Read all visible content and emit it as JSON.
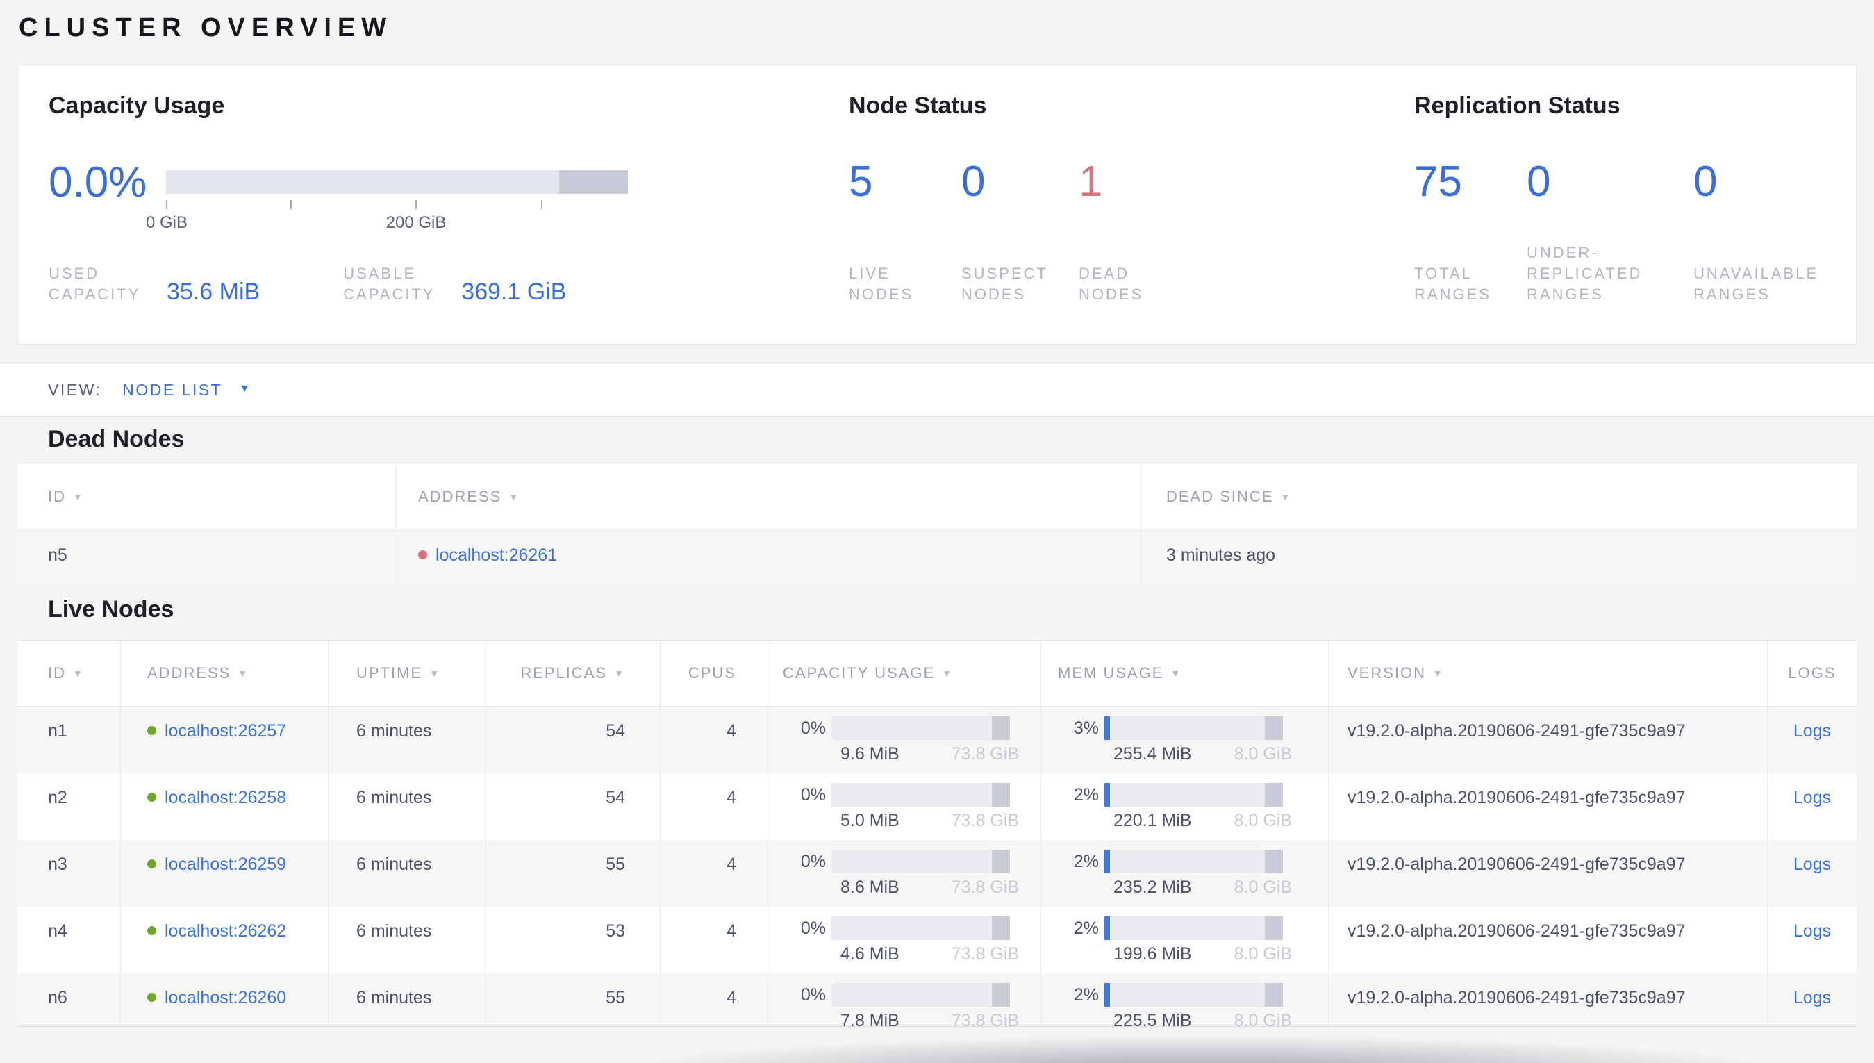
{
  "page": {
    "title": "CLUSTER OVERVIEW"
  },
  "colors": {
    "accent_blue": "#3a6fd8",
    "status_red": "#d9707e",
    "status_green": "#71a82b"
  },
  "overview": {
    "capacity": {
      "title": "Capacity Usage",
      "percent": "0.0%",
      "tick_labels": [
        "0 GiB",
        "200 GiB"
      ],
      "used_label": "USED CAPACITY",
      "used_value": "35.6 MiB",
      "usable_label": "USABLE CAPACITY",
      "usable_value": "369.1 GiB"
    },
    "node_status": {
      "title": "Node Status",
      "stats": [
        {
          "value": "5",
          "label": "LIVE NODES",
          "color": "#3a6fd8"
        },
        {
          "value": "0",
          "label": "SUSPECT NODES",
          "color": "#3a6fd8"
        },
        {
          "value": "1",
          "label": "DEAD NODES",
          "color": "#d9707e"
        }
      ]
    },
    "replication": {
      "title": "Replication Status",
      "stats": [
        {
          "value": "75",
          "label": "TOTAL RANGES"
        },
        {
          "value": "0",
          "label": "UNDER-REPLICATED RANGES"
        },
        {
          "value": "0",
          "label": "UNAVAILABLE RANGES"
        }
      ]
    }
  },
  "view_bar": {
    "label": "VIEW:",
    "selected": "NODE LIST"
  },
  "dead_nodes": {
    "title": "Dead Nodes",
    "columns": [
      {
        "key": "id",
        "label": "ID",
        "sortable": true
      },
      {
        "key": "address",
        "label": "ADDRESS",
        "sortable": true
      },
      {
        "key": "deadsince",
        "label": "DEAD SINCE",
        "sortable": true
      }
    ],
    "rows": [
      {
        "id": "n5",
        "address": "localhost:26261",
        "dead_since": "3 minutes ago"
      }
    ]
  },
  "live_nodes": {
    "title": "Live Nodes",
    "columns": [
      {
        "key": "id",
        "label": "ID",
        "sortable": true
      },
      {
        "key": "address",
        "label": "ADDRESS",
        "sortable": true
      },
      {
        "key": "uptime",
        "label": "UPTIME",
        "sortable": true
      },
      {
        "key": "replicas",
        "label": "REPLICAS",
        "sortable": true
      },
      {
        "key": "cpus",
        "label": "CPUS",
        "sortable": false
      },
      {
        "key": "capacity",
        "label": "CAPACITY USAGE",
        "sortable": true
      },
      {
        "key": "mem",
        "label": "MEM USAGE",
        "sortable": true
      },
      {
        "key": "version",
        "label": "VERSION",
        "sortable": true
      },
      {
        "key": "logs",
        "label": "LOGS",
        "sortable": false
      }
    ],
    "rows": [
      {
        "id": "n1",
        "address": "localhost:26257",
        "uptime": "6 minutes",
        "replicas": "54",
        "cpus": "4",
        "capacity": {
          "percent": "0%",
          "used": "9.6 MiB",
          "total": "73.8 GiB",
          "fill_pct": 0
        },
        "mem": {
          "percent": "3%",
          "used": "255.4 MiB",
          "total": "8.0 GiB",
          "fill_pct": 3
        },
        "version": "v19.2.0-alpha.20190606-2491-gfe735c9a97",
        "logs": "Logs"
      },
      {
        "id": "n2",
        "address": "localhost:26258",
        "uptime": "6 minutes",
        "replicas": "54",
        "cpus": "4",
        "capacity": {
          "percent": "0%",
          "used": "5.0 MiB",
          "total": "73.8 GiB",
          "fill_pct": 0
        },
        "mem": {
          "percent": "2%",
          "used": "220.1 MiB",
          "total": "8.0 GiB",
          "fill_pct": 2
        },
        "version": "v19.2.0-alpha.20190606-2491-gfe735c9a97",
        "logs": "Logs"
      },
      {
        "id": "n3",
        "address": "localhost:26259",
        "uptime": "6 minutes",
        "replicas": "55",
        "cpus": "4",
        "capacity": {
          "percent": "0%",
          "used": "8.6 MiB",
          "total": "73.8 GiB",
          "fill_pct": 0
        },
        "mem": {
          "percent": "2%",
          "used": "235.2 MiB",
          "total": "8.0 GiB",
          "fill_pct": 2
        },
        "version": "v19.2.0-alpha.20190606-2491-gfe735c9a97",
        "logs": "Logs"
      },
      {
        "id": "n4",
        "address": "localhost:26262",
        "uptime": "6 minutes",
        "replicas": "53",
        "cpus": "4",
        "capacity": {
          "percent": "0%",
          "used": "4.6 MiB",
          "total": "73.8 GiB",
          "fill_pct": 0
        },
        "mem": {
          "percent": "2%",
          "used": "199.6 MiB",
          "total": "8.0 GiB",
          "fill_pct": 2
        },
        "version": "v19.2.0-alpha.20190606-2491-gfe735c9a97",
        "logs": "Logs"
      },
      {
        "id": "n6",
        "address": "localhost:26260",
        "uptime": "6 minutes",
        "replicas": "55",
        "cpus": "4",
        "capacity": {
          "percent": "0%",
          "used": "7.8 MiB",
          "total": "73.8 GiB",
          "fill_pct": 0
        },
        "mem": {
          "percent": "2%",
          "used": "225.5 MiB",
          "total": "8.0 GiB",
          "fill_pct": 2
        },
        "version": "v19.2.0-alpha.20190606-2491-gfe735c9a97",
        "logs": "Logs"
      }
    ]
  }
}
